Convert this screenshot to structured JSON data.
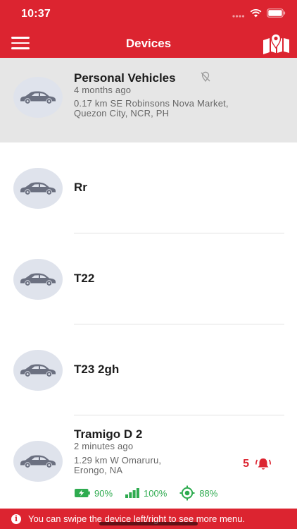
{
  "status": {
    "time": "10:37"
  },
  "nav": {
    "title": "Devices",
    "menu_icon": "hamburger-menu-icon",
    "map_icon": "map-pin-icon"
  },
  "devices": [
    {
      "name": "Personal Vehicles",
      "last_seen": "4 months ago",
      "address_line1": "0.17 km SE Robinsons Nova Market,",
      "address_line2": "Quezon City, NCR, PH",
      "gps_status_icon": "gps-off-icon"
    },
    {
      "name": "Rr"
    },
    {
      "name": "T22"
    },
    {
      "name": "T23 2gh"
    },
    {
      "name": "Tramigo D 2",
      "last_seen": "2 minutes ago",
      "address_line1": "1.29 km W Omaruru,",
      "address_line2": "Erongo, NA",
      "alarm_count": "5",
      "battery": "90%",
      "signal": "100%",
      "gps": "88%"
    }
  ],
  "toast": {
    "text": "You can swipe the device left/right to see more menu."
  },
  "colors": {
    "brand": "#dc2430",
    "selected_row": "#e6e6e6",
    "avatar_bg": "#dfe3ec",
    "ok_green": "#2eab4f"
  }
}
